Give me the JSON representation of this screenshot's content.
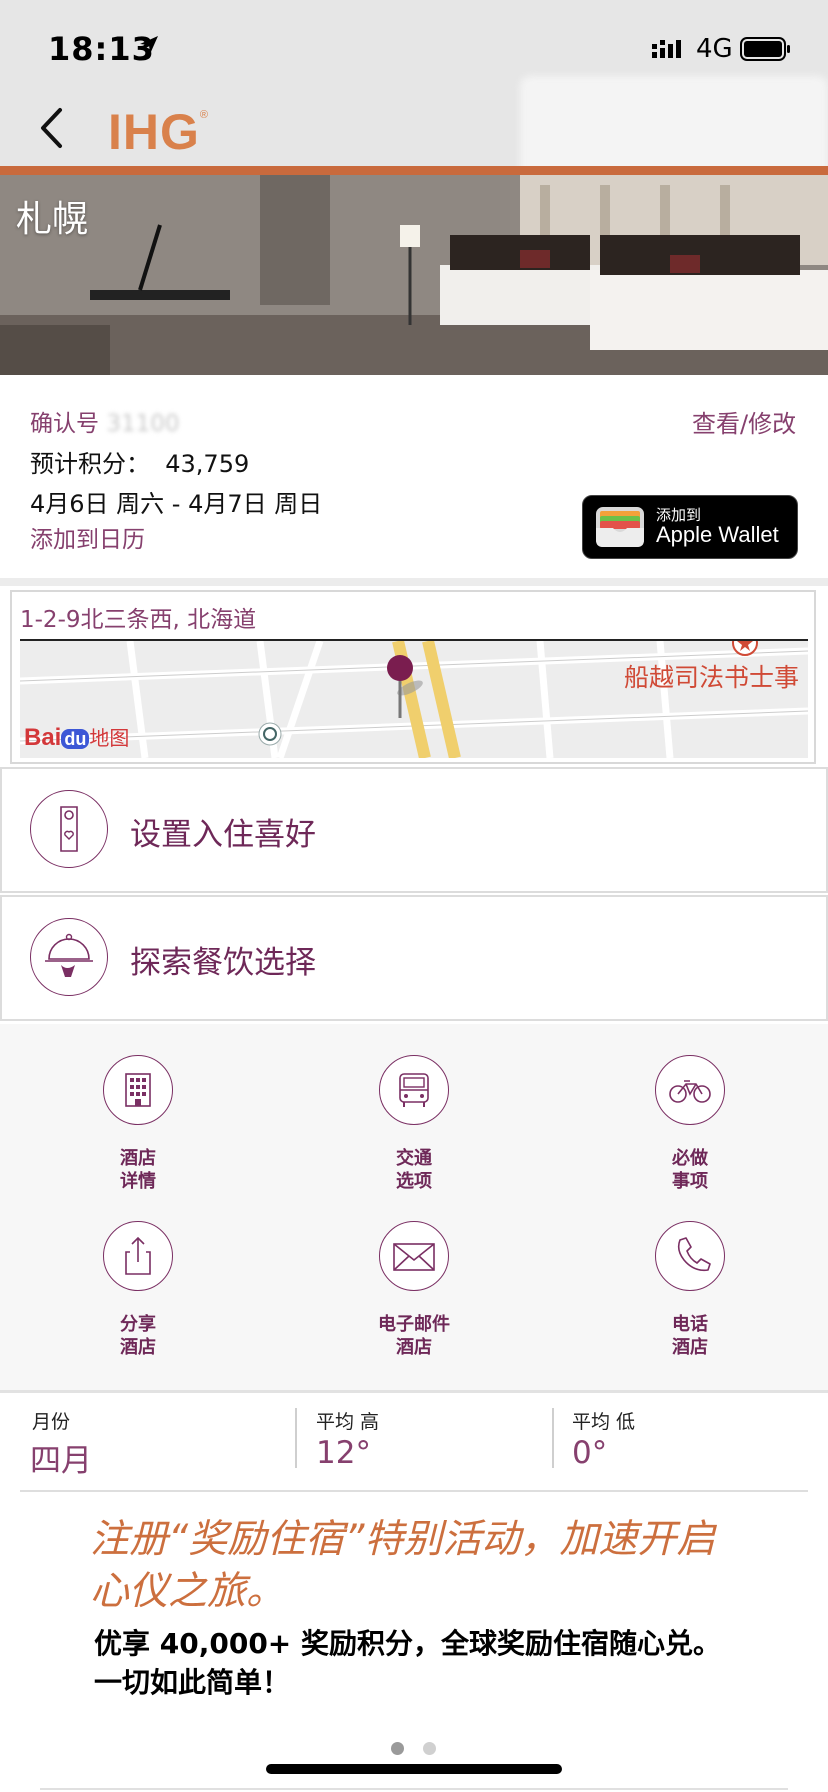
{
  "status_bar": {
    "time": "18:13",
    "network": "4G",
    "icons": [
      "location-arrow-icon",
      "signal-icon",
      "battery-icon"
    ]
  },
  "header": {
    "brand": "IHG",
    "brand_mark": "®",
    "back_icon": "chevron-left-icon",
    "brand_color": "#d9814b",
    "accent_line_color": "#c96a3d"
  },
  "hero": {
    "city": "札幌"
  },
  "booking": {
    "confirmation_label": "确认号",
    "confirmation_number": "31100",
    "points_label": "预计积分：",
    "points_value": "43,759",
    "dates": "4月6日 周六 - 4月7日 周日",
    "add_calendar": "添加到日历",
    "view_modify": "查看/修改",
    "wallet_small": "添加到",
    "wallet_big": "Apple Wallet"
  },
  "map": {
    "address": "1-2-9北三条西, 北海道",
    "poi": "船越司法书士事",
    "provider": "Bai",
    "provider_du": "du",
    "provider_suffix": "地图"
  },
  "actions": [
    {
      "label": "设置入住喜好",
      "icon": "door-hanger-icon"
    },
    {
      "label": "探索餐饮选择",
      "icon": "food-cloche-icon"
    }
  ],
  "grid": [
    {
      "line1": "酒店",
      "line2": "详情",
      "icon": "building-icon"
    },
    {
      "line1": "交通",
      "line2": "选项",
      "icon": "bus-icon"
    },
    {
      "line1": "必做",
      "line2": "事项",
      "icon": "bicycle-icon"
    },
    {
      "line1": "分享",
      "line2": "酒店",
      "icon": "share-icon"
    },
    {
      "line1": "电子邮件",
      "line2": "酒店",
      "icon": "envelope-icon"
    },
    {
      "line1": "电话",
      "line2": "酒店",
      "icon": "phone-icon"
    }
  ],
  "weather": {
    "month_label": "月份",
    "month_value": "四月",
    "high_label": "平均 高",
    "high_value": "12°",
    "low_label": "平均 低",
    "low_value": "0°"
  },
  "promo": {
    "title": "注册“奖励住宿”特别活动，加速开启心仪之旅。",
    "body": "优享 40,000+ 奖励积分，全球奖励住宿随心兑。一切如此简单！",
    "pages": 2,
    "active_page": 1
  },
  "colors": {
    "primary": "#86406e",
    "icon_stroke": "#7a2f63",
    "promo_title": "#cc6f3e"
  }
}
